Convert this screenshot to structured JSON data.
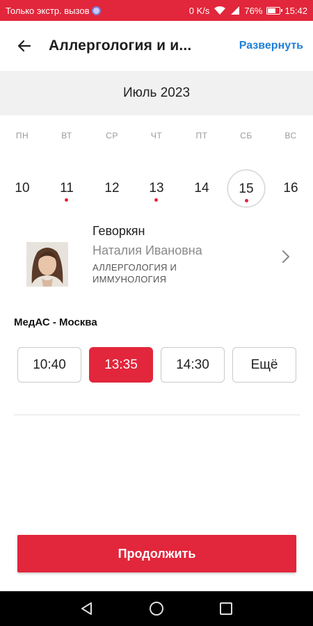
{
  "status_bar": {
    "carrier_text": "Только экстр. вызов",
    "net_speed": "0 K/s",
    "battery": "76%",
    "battery_level": 0.76,
    "time": "15:42",
    "icons": [
      "emergency-icon",
      "wifi-icon",
      "cell-signal-icon",
      "battery-icon"
    ]
  },
  "header": {
    "title": "Аллергология и и...",
    "expand_label": "Развернуть",
    "back_icon": "arrow-left-icon"
  },
  "calendar": {
    "month": "Июль 2023",
    "weekdays": [
      "ПН",
      "ВТ",
      "СР",
      "ЧТ",
      "ПТ",
      "СБ",
      "ВС"
    ],
    "days": [
      {
        "num": "10",
        "has_slots": false,
        "selected": false
      },
      {
        "num": "11",
        "has_slots": true,
        "selected": false
      },
      {
        "num": "12",
        "has_slots": false,
        "selected": false
      },
      {
        "num": "13",
        "has_slots": true,
        "selected": false
      },
      {
        "num": "14",
        "has_slots": false,
        "selected": false
      },
      {
        "num": "15",
        "has_slots": true,
        "selected": true
      },
      {
        "num": "16",
        "has_slots": false,
        "selected": false
      }
    ]
  },
  "doctor": {
    "last_name": "Геворкян",
    "first_name": "Наталия Ивановна",
    "specialty": "АЛЛЕРГОЛОГИЯ И ИММУНОЛОГИЯ"
  },
  "clinic": {
    "name": "МедАС - Москва",
    "slots": [
      {
        "label": "10:40",
        "active": false
      },
      {
        "label": "13:35",
        "active": true
      },
      {
        "label": "14:30",
        "active": false
      },
      {
        "label": "Ещё",
        "active": false
      }
    ]
  },
  "continue_label": "Продолжить",
  "colors": {
    "accent": "#e2263b",
    "link": "#1e7fd8",
    "month_band": "#f1f1f1"
  },
  "navbar": {
    "icons": [
      "back-triangle-icon",
      "home-circle-icon",
      "recents-square-icon"
    ]
  }
}
